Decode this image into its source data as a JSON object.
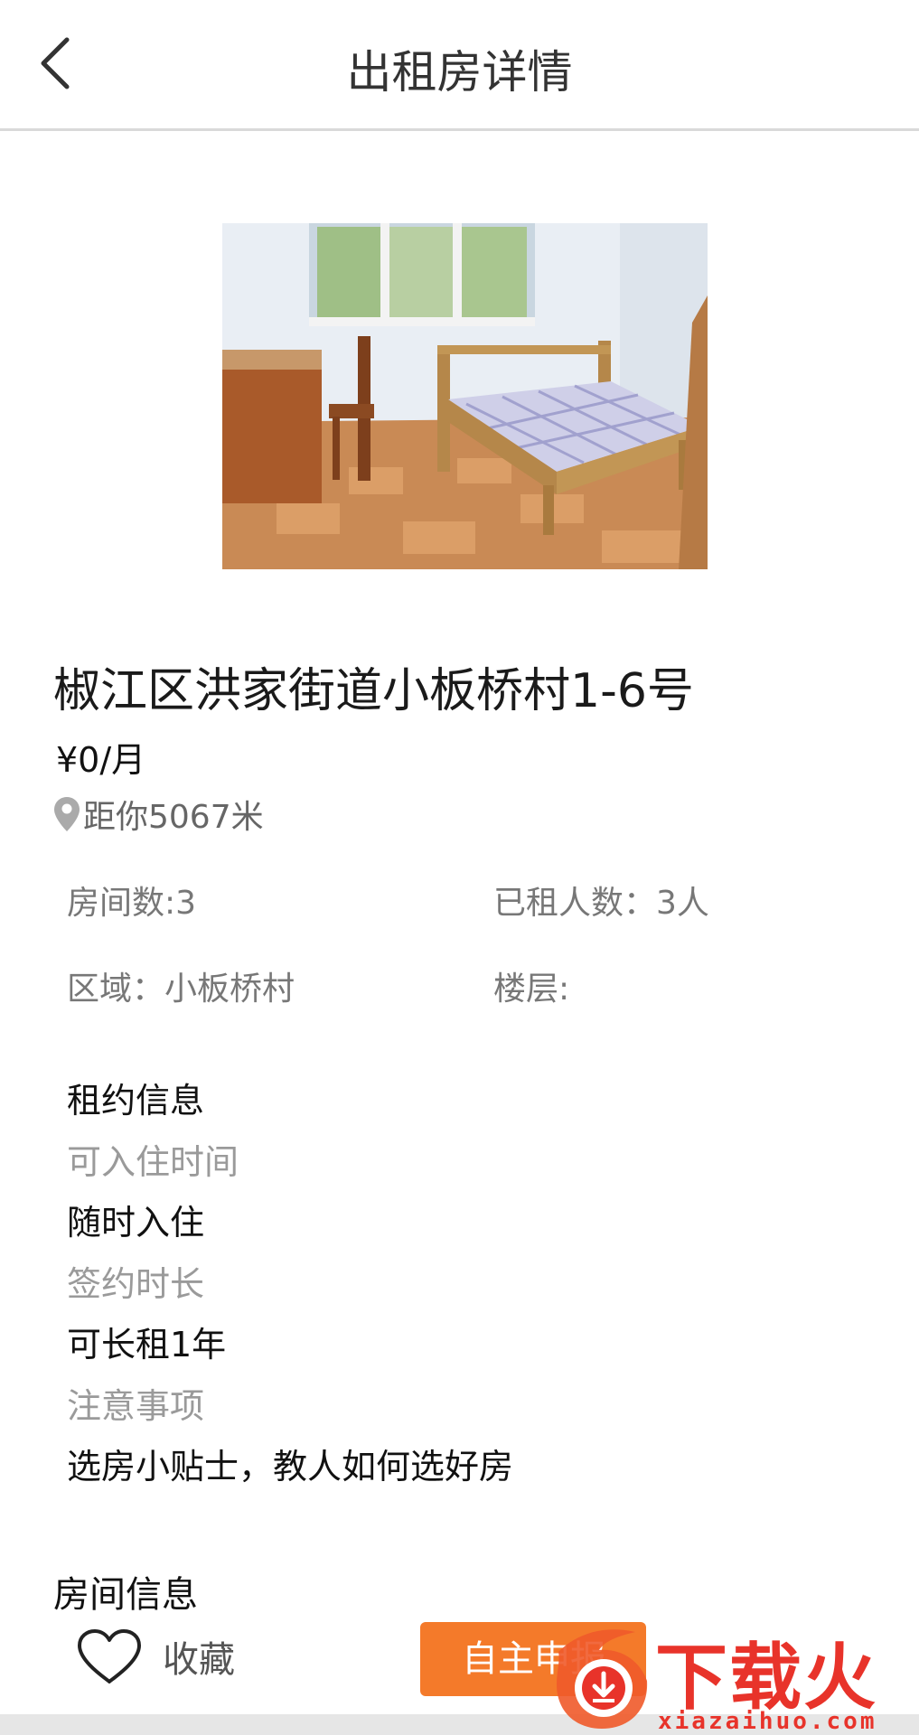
{
  "header": {
    "title": "出租房详情",
    "back_icon": "chevron-left-icon"
  },
  "listing": {
    "photo_alt": "",
    "address": "椒江区洪家街道小板桥村1-6号",
    "price": "¥0/月",
    "distance_icon": "map-pin-icon",
    "distance": "距你5067米"
  },
  "details": {
    "rooms": "房间数:3",
    "rented": "已租人数：3人",
    "area": "区域：小板桥村",
    "floor": "楼层:"
  },
  "lease": {
    "heading": "租约信息",
    "move_in_label": "可入住时间",
    "move_in_value": "随时入住",
    "term_label": "签约时长",
    "term_value": "可长租1年",
    "notes_label": "注意事项",
    "notes_value": "选房小贴士，教人如何选好房"
  },
  "room_info_heading": "房间信息",
  "bottom_bar": {
    "favorite_label": "收藏",
    "favorite_icon": "heart-outline-icon",
    "apply_label": "自主申报"
  },
  "watermark": {
    "brand": "下载火",
    "url": "xiazaihuo.com"
  },
  "colors": {
    "accent": "#f47a2a",
    "divider": "#d9d9d9",
    "muted_text": "#9a9a9a",
    "watermark": "#e8332a"
  }
}
